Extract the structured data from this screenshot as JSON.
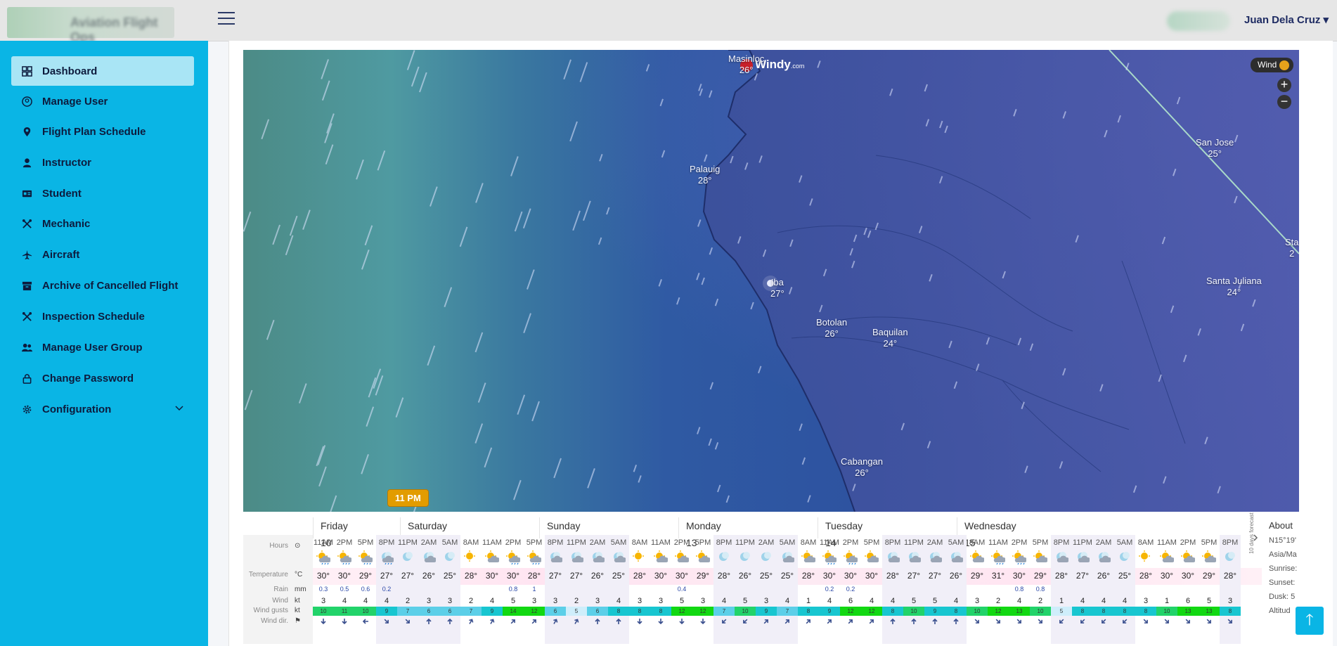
{
  "header": {
    "brand_text": "Aviation Flight Ops",
    "user_name": "Juan Dela Cruz",
    "user_caret": "▾"
  },
  "sidebar": {
    "items": [
      {
        "label": "Dashboard",
        "icon": "dashboard-icon"
      },
      {
        "label": "Manage User",
        "icon": "user-circle-icon"
      },
      {
        "label": "Flight Plan Schedule",
        "icon": "map-pin-icon"
      },
      {
        "label": "Instructor",
        "icon": "person-icon"
      },
      {
        "label": "Student",
        "icon": "id-card-icon"
      },
      {
        "label": "Mechanic",
        "icon": "tools-icon"
      },
      {
        "label": "Aircraft",
        "icon": "plane-icon"
      },
      {
        "label": "Archive of Cancelled Flight",
        "icon": "archive-icon"
      },
      {
        "label": "Inspection Schedule",
        "icon": "tools-icon"
      },
      {
        "label": "Manage User Group",
        "icon": "users-icon"
      },
      {
        "label": "Change Password",
        "icon": "lock-icon"
      },
      {
        "label": "Configuration",
        "icon": "gear-icon"
      }
    ]
  },
  "map": {
    "logo_text": "Windy",
    "logo_suffix": ".com",
    "layer_label": "Wind",
    "zoom_in": "+",
    "zoom_out": "−",
    "cities": [
      {
        "name": "Masinloc",
        "temp": "26°"
      },
      {
        "name": "Palauig",
        "temp": "28°"
      },
      {
        "name": "Iba",
        "temp": "27°"
      },
      {
        "name": "Botolan",
        "temp": "26°"
      },
      {
        "name": "Baquilan",
        "temp": "24°"
      },
      {
        "name": "Cabangan",
        "temp": "26°"
      },
      {
        "name": "San Jose",
        "temp": "25°"
      },
      {
        "name": "Santa Juliana",
        "temp": "24°"
      },
      {
        "name": "Sta",
        "temp": "2"
      }
    ]
  },
  "forecast": {
    "current_time": "11 PM",
    "days": [
      "Friday 10",
      "Saturday 11",
      "Sunday 12",
      "Monday 13",
      "Tuesday 14",
      "Wednesday 15"
    ],
    "row_labels": [
      {
        "label": "Hours",
        "unit": "⊙"
      },
      {
        "label": "Temperature",
        "unit": "°C"
      },
      {
        "label": "Rain",
        "unit": "mm"
      },
      {
        "label": "Wind",
        "unit": "kt"
      },
      {
        "label": "Wind gusts",
        "unit": "kt"
      },
      {
        "label": "Wind dir.",
        "unit": "⚑"
      }
    ],
    "hours": [
      "11AM",
      "2PM",
      "5PM",
      "8PM",
      "11PM",
      "2AM",
      "5AM",
      "8AM",
      "11AM",
      "2PM",
      "5PM",
      "8PM",
      "11PM",
      "2AM",
      "5AM",
      "8AM",
      "11AM",
      "2PM",
      "5PM",
      "8PM",
      "11PM",
      "2AM",
      "5AM",
      "8AM",
      "11AM",
      "2PM",
      "5PM",
      "8PM",
      "11PM",
      "2AM",
      "5AM",
      "8AM",
      "11AM",
      "2PM",
      "5PM",
      "8PM",
      "11PM",
      "2AM",
      "5AM",
      "8AM",
      "11AM",
      "2PM",
      "5PM",
      "8PM"
    ],
    "icons": [
      "sun-cloud-rain",
      "sun-cloud-rain",
      "sun-cloud-rain",
      "moon-cloud-rain",
      "moon",
      "moon-cloud",
      "moon",
      "sun",
      "sun-cloud",
      "sun-cloud-rain",
      "sun-cloud-rain",
      "moon-cloud",
      "moon-cloud",
      "moon-cloud",
      "moon-cloud",
      "sun",
      "sun-cloud",
      "sun-cloud",
      "sun-cloud",
      "moon",
      "moon",
      "moon",
      "moon-cloud",
      "cloud-sun",
      "sun-cloud-rain",
      "sun-cloud-rain",
      "sun-cloud",
      "moon-cloud",
      "moon-cloud",
      "moon-cloud",
      "moon-cloud",
      "sun-cloud",
      "sun-cloud-rain",
      "sun-cloud-rain",
      "sun-cloud",
      "moon-cloud",
      "moon-cloud",
      "moon-cloud",
      "moon",
      "sun",
      "sun-cloud",
      "sun-cloud",
      "sun-cloud",
      "moon"
    ],
    "temps": [
      "30°",
      "30°",
      "29°",
      "27°",
      "27°",
      "26°",
      "25°",
      "28°",
      "30°",
      "30°",
      "28°",
      "27°",
      "27°",
      "26°",
      "25°",
      "28°",
      "30°",
      "30°",
      "29°",
      "28°",
      "26°",
      "25°",
      "25°",
      "28°",
      "30°",
      "30°",
      "30°",
      "28°",
      "27°",
      "27°",
      "26°",
      "29°",
      "31°",
      "30°",
      "29°",
      "28°",
      "27°",
      "26°",
      "25°",
      "28°",
      "30°",
      "30°",
      "29°",
      "28°"
    ],
    "rain": [
      "0.3",
      "0.5",
      "0.6",
      "0.2",
      "",
      "",
      "",
      "",
      "",
      "0.8",
      "1",
      "",
      "",
      "",
      "",
      "",
      "",
      "0.4",
      "",
      "",
      "",
      "",
      "",
      "",
      "0.2",
      "0.2",
      "",
      "",
      "",
      "",
      "",
      "",
      "",
      "0.8",
      "0.8",
      "",
      "",
      "",
      "",
      "",
      "",
      "",
      "",
      ""
    ],
    "wind": [
      "3",
      "4",
      "4",
      "4",
      "2",
      "3",
      "3",
      "2",
      "4",
      "5",
      "3",
      "3",
      "2",
      "3",
      "4",
      "3",
      "3",
      "5",
      "3",
      "4",
      "5",
      "3",
      "4",
      "1",
      "4",
      "6",
      "4",
      "4",
      "5",
      "5",
      "4",
      "3",
      "2",
      "4",
      "2",
      "1",
      "4",
      "4",
      "4",
      "3",
      "1",
      "6",
      "5",
      "3"
    ],
    "gusts": [
      "10",
      "11",
      "10",
      "9",
      "7",
      "6",
      "6",
      "7",
      "9",
      "14",
      "12",
      "6",
      "5",
      "6",
      "8",
      "8",
      "8",
      "12",
      "12",
      "7",
      "10",
      "9",
      "7",
      "8",
      "9",
      "12",
      "12",
      "8",
      "10",
      "9",
      "8",
      "10",
      "12",
      "13",
      "10",
      "5",
      "8",
      "8",
      "8",
      "8",
      "10",
      "13",
      "13",
      "8"
    ],
    "about_title": "About",
    "about_lines": [
      "N15°19'",
      "Asia/Ma",
      "Sunrise:",
      "Sunset:",
      "Dusk: 5",
      "Altitud"
    ],
    "ten_day_label": "10 days forecast"
  },
  "colors": {
    "sidebar": "#0ab5e5",
    "sidebar_active": "#a9e5f5",
    "accent": "#e29c00"
  },
  "scroll_top_symbol": "🡑"
}
